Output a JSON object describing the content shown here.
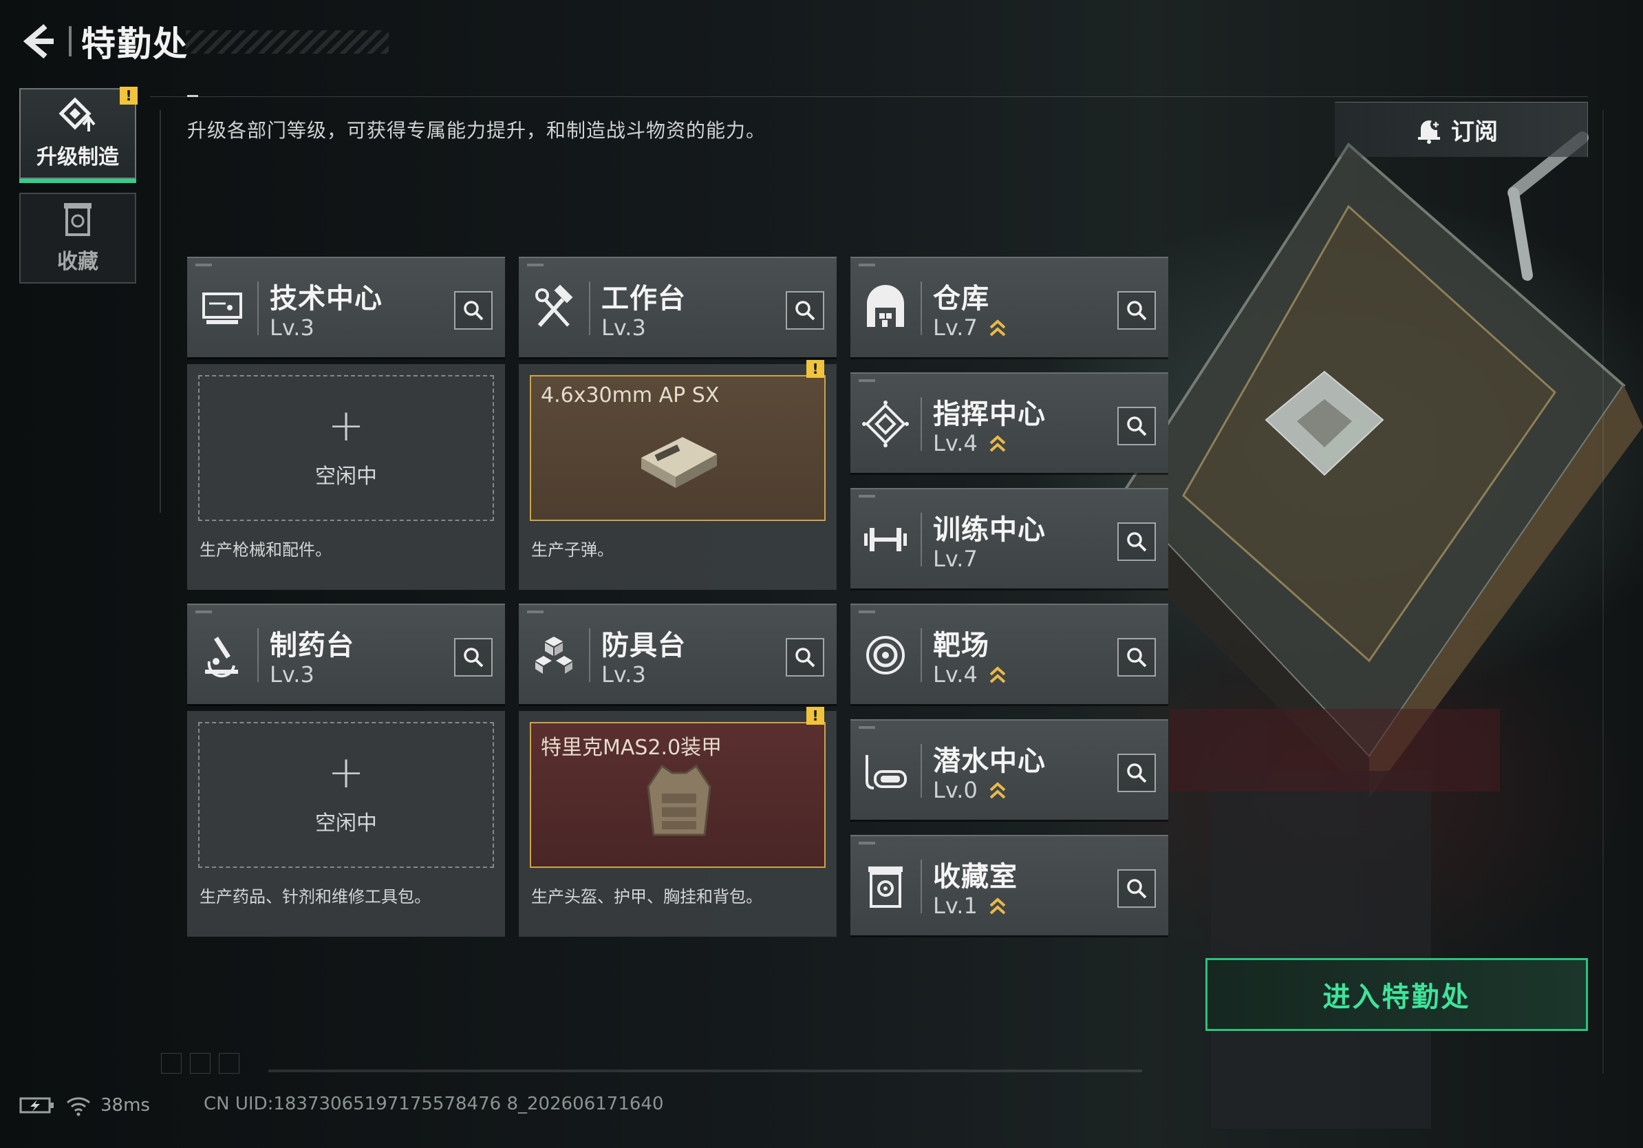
{
  "header": {
    "title": "特勤处"
  },
  "nav": {
    "tabs": [
      {
        "label": "升级制造",
        "icon": "upgrade-icon",
        "active": true,
        "warning": "!"
      },
      {
        "label": "收藏",
        "icon": "collection-icon",
        "active": false
      }
    ]
  },
  "description": "升级各部门等级，可获得专属能力提升，和制造战斗物资的能力。",
  "subscribe": {
    "label": "订阅",
    "icon": "bell-plus-icon"
  },
  "facilities": [
    {
      "name": "技术中心",
      "level": "Lv.3",
      "icon": "computer-icon",
      "upgradable": false
    },
    {
      "name": "工作台",
      "level": "Lv.3",
      "icon": "hammer-wrench-icon",
      "upgradable": false
    },
    {
      "name": "仓库",
      "level": "Lv.7",
      "icon": "warehouse-icon",
      "upgradable": true
    },
    {
      "name": "指挥中心",
      "level": "Lv.4",
      "icon": "command-diamond-icon",
      "upgradable": true
    },
    {
      "name": "训练中心",
      "level": "Lv.7",
      "icon": "dumbbell-icon",
      "upgradable": false
    },
    {
      "name": "制药台",
      "level": "Lv.3",
      "icon": "microscope-icon",
      "upgradable": false
    },
    {
      "name": "防具台",
      "level": "Lv.3",
      "icon": "cubes-icon",
      "upgradable": false
    },
    {
      "name": "靶场",
      "level": "Lv.4",
      "icon": "target-icon",
      "upgradable": true
    },
    {
      "name": "潜水中心",
      "level": "Lv.0",
      "icon": "diving-mask-icon",
      "upgradable": true
    },
    {
      "name": "收藏室",
      "level": "Lv.1",
      "icon": "collection-room-icon",
      "upgradable": true
    }
  ],
  "production": {
    "tech_center": {
      "status": "空闲中",
      "desc": "生产枪械和配件。"
    },
    "workbench": {
      "item": "4.6x30mm AP SX",
      "desc": "生产子弹。",
      "warning": "!"
    },
    "pharmacy": {
      "status": "空闲中",
      "desc": "生产药品、针剂和维修工具包。"
    },
    "armor_bench": {
      "item": "特里克MAS2.0装甲",
      "desc": "生产头盔、护甲、胸挂和背包。",
      "warning": "!"
    }
  },
  "enter_button": {
    "label": "进入特勤处"
  },
  "status": {
    "ping": "38ms",
    "uid": "CN UID:18373065197175578476 8_202606171640"
  },
  "colors": {
    "accent": "#2fd08a",
    "warning": "#f0c43c",
    "upgrade_arrow": "#e9b949"
  }
}
